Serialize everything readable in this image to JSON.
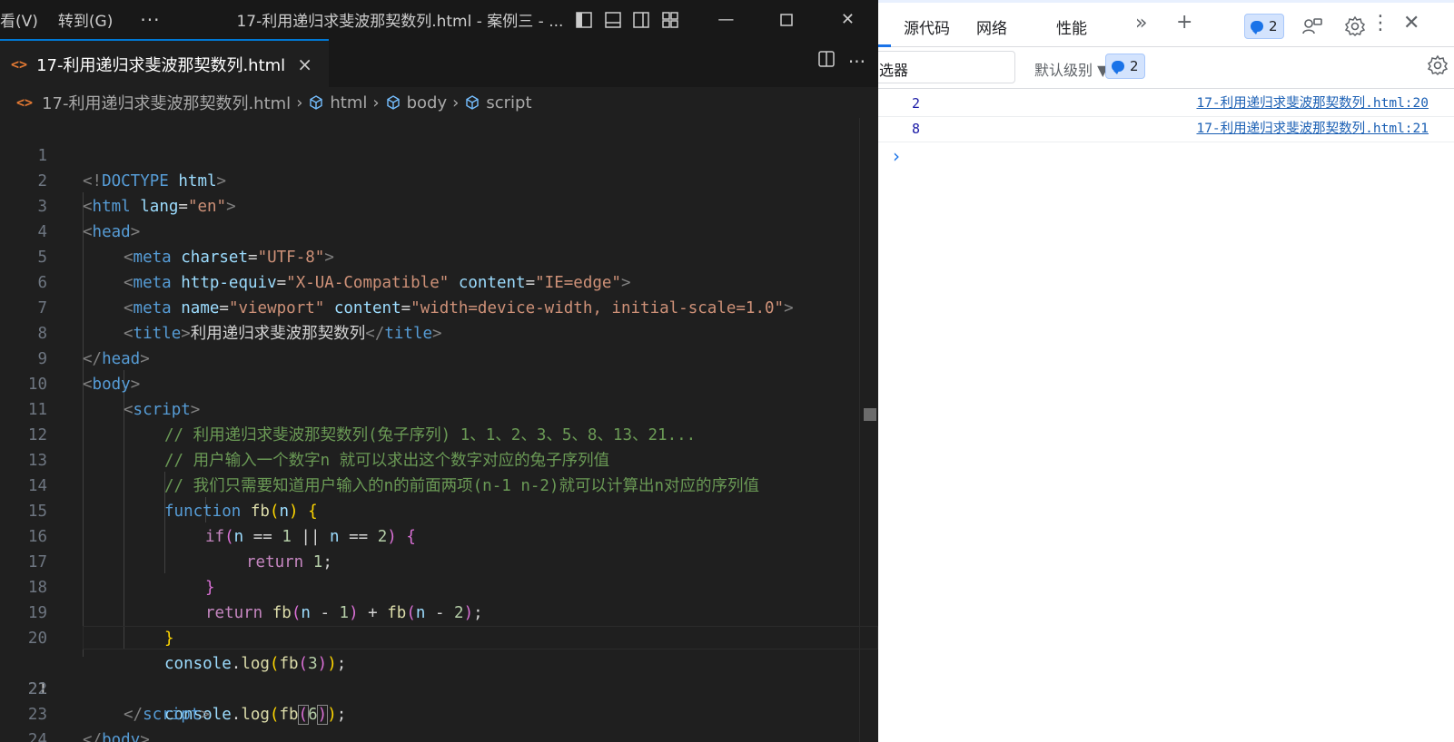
{
  "editor": {
    "menu": [
      "看(V)",
      "转到(G)"
    ],
    "more": "···",
    "window_title": "17-利用递归求斐波那契数列.html - 案例三 - ...",
    "tab": {
      "label": "17-利用递归求斐波那契数列.html",
      "close": "×"
    },
    "breadcrumb": {
      "file": "17-利用递归求斐波那契数列.html",
      "items": [
        "html",
        "body",
        "script"
      ]
    },
    "line_numbers": [
      "1",
      "2",
      "3",
      "4",
      "5",
      "6",
      "7",
      "8",
      "9",
      "10",
      "11",
      "12",
      "13",
      "14",
      "15",
      "16",
      "17",
      "18",
      "19",
      "20",
      "21",
      "22",
      "23",
      "24"
    ],
    "current_line": "21",
    "code": {
      "l1a": "<!",
      "l1b": "DOCTYPE",
      "l1c": " html",
      "l1d": ">",
      "l2_tag": "html",
      "l2_attr": "lang",
      "l2_val": "\"en\"",
      "head": "head",
      "meta": "meta",
      "l4_attr": "charset",
      "l4_val": "\"UTF-8\"",
      "l5_attr1": "http-equiv",
      "l5_val1": "\"X-UA-Compatible\"",
      "l5_attr2": "content",
      "l5_val2": "\"IE=edge\"",
      "l6_attr1": "name",
      "l6_val1": "\"viewport\"",
      "l6_attr2": "content",
      "l6_val2": "\"width=device-width, initial-scale=1.0\"",
      "title_tag": "title",
      "title_text": "利用递归求斐波那契数列",
      "body": "body",
      "script": "script",
      "c11": "// 利用递归求斐波那契数列(兔子序列) 1、1、2、3、5、8、13、21...",
      "c12": "// 用户输入一个数字n 就可以求出这个数字对应的兔子序列值",
      "c13": "// 我们只需要知道用户输入的n的前面两项(n-1 n-2)就可以计算出n对应的序列值",
      "kw_function": "function",
      "fn_fb": "fb",
      "var_n": "n",
      "kw_if": "if",
      "eq": " == ",
      "or": " || ",
      "one": "1",
      "two": "2",
      "three": "3",
      "six": "6",
      "kw_return": "return",
      "console": "console",
      "log": "log"
    }
  },
  "devtools": {
    "tabs": [
      "源代码",
      "网络",
      "性能"
    ],
    "issues_count": "2",
    "filter_placeholder": "选器",
    "levels": "默认级别 ▼",
    "messages_count": "2",
    "messages": [
      {
        "value": "2",
        "source": "17-利用递归求斐波那契数列.html:20"
      },
      {
        "value": "8",
        "source": "17-利用递归求斐波那契数列.html:21"
      }
    ],
    "prompt": "›"
  },
  "colors": {
    "editor_bg": "#1f1f1f",
    "accent": "#0078d4",
    "devtools_bg": "#ffffff",
    "link": "#1a5fb4"
  }
}
